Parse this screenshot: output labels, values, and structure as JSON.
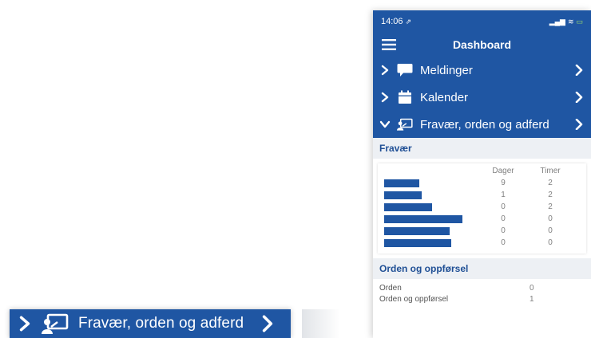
{
  "zoom": {
    "label": "Fravær, orden og adferd"
  },
  "status_bar": {
    "time": "14:06",
    "location_glyph": "⇗",
    "signal_glyph": "▂▄▆",
    "wifi_glyph": "≋",
    "battery_glyph": "▭"
  },
  "header": {
    "title": "Dashboard"
  },
  "menu": [
    {
      "label": "Meldinger",
      "icon": "chat-bubble-icon",
      "expanded": false
    },
    {
      "label": "Kalender",
      "icon": "calendar-icon",
      "expanded": false
    },
    {
      "label": "Fravær, orden og adferd",
      "icon": "classroom-icon",
      "expanded": true
    }
  ],
  "fravaer": {
    "heading": "Fravær",
    "columns": [
      "Dager",
      "Timer"
    ],
    "rows": [
      {
        "bar_fraction": 0.45,
        "dager": "9",
        "timer": "2"
      },
      {
        "bar_fraction": 0.48,
        "dager": "1",
        "timer": "2"
      },
      {
        "bar_fraction": 0.61,
        "dager": "0",
        "timer": "2"
      },
      {
        "bar_fraction": 1.0,
        "dager": "0",
        "timer": "0"
      },
      {
        "bar_fraction": 0.84,
        "dager": "0",
        "timer": "0"
      },
      {
        "bar_fraction": 0.86,
        "dager": "0",
        "timer": "0"
      }
    ]
  },
  "orden": {
    "heading": "Orden og oppførsel",
    "rows": [
      {
        "label": "Orden",
        "value": "0"
      },
      {
        "label": "Orden og oppførsel",
        "value": "1"
      }
    ]
  },
  "colors": {
    "brand_blue": "#1f56a3",
    "section_bg": "#edf0f4"
  }
}
